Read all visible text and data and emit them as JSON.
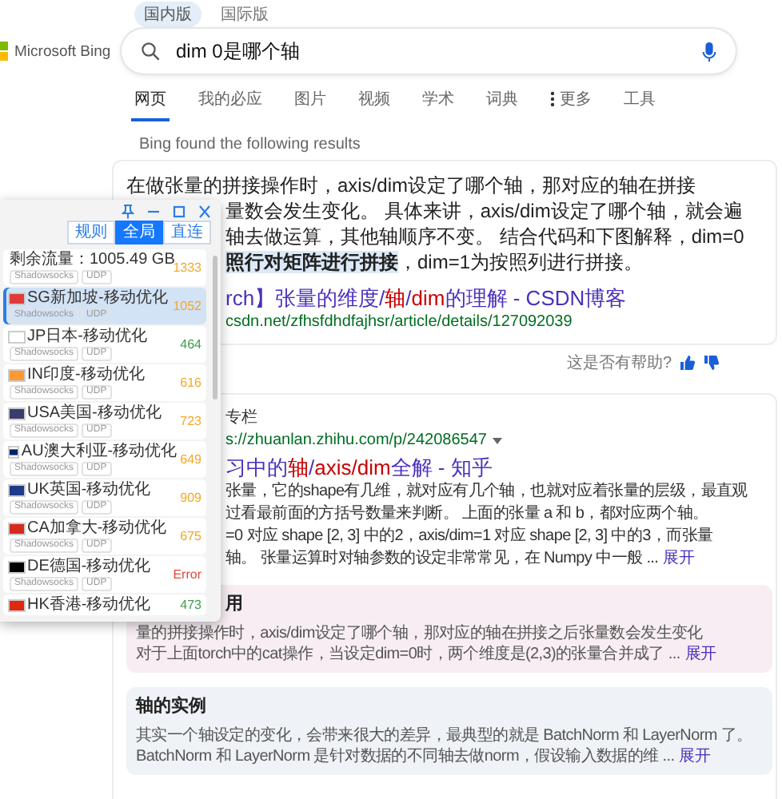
{
  "region_tabs": [
    {
      "label": "国内版",
      "selected": true
    },
    {
      "label": "国际版",
      "selected": false
    }
  ],
  "logo": {
    "text": "Microsoft Bing"
  },
  "search": {
    "value": "dim 0是哪个轴"
  },
  "nav": [
    {
      "label": "网页",
      "kind": "link",
      "selected": true
    },
    {
      "label": "我的必应",
      "kind": "link",
      "selected": false
    },
    {
      "label": "图片",
      "kind": "link",
      "selected": false
    },
    {
      "label": "视频",
      "kind": "link",
      "selected": false
    },
    {
      "label": "学术",
      "kind": "link",
      "selected": false
    },
    {
      "label": "词典",
      "kind": "link",
      "selected": false
    },
    {
      "label": "更多",
      "kind": "menu",
      "selected": false
    },
    {
      "label": "工具",
      "kind": "link",
      "selected": false
    }
  ],
  "results_heading": "Bing found the following results",
  "answer": {
    "lines": [
      "在做张量的拼接操作时，axis/dim设定了哪个轴，那对应的轴在拼接",
      "量数会发生变化。 具体来讲，axis/dim设定了哪个轴，就会遍",
      "轴去做运算，其他轴顺序不变。 结合代码和下图解释，dim=0",
      "**照行对矩阵进行拼接**，dim=1为按照列进行拼接。"
    ],
    "title": "rch】张量的维度/**轴**/**dim**的理解 - CSDN博客",
    "url": "csdn.net/zfhsfdhdfajhsr/article/details/127092039",
    "feedback": "这是否有帮助?"
  },
  "result": {
    "source": "专栏",
    "url": "s://zhuanlan.zhihu.com/p/242086547",
    "title": "习中的**轴**/**axis/dim**全解 - 知乎",
    "lines": [
      "张量，它的shape有几维，就对应有几个轴，也就对应着张量的层级，最直观",
      "过看最前面的方括号数量来判断。 上面的张量 a 和 b，都对应两个轴。",
      "=0 对应 shape [2, 3] 中的2，axis/dim=1 对应 shape [2, 3] 中的3，而张量",
      "轴。 张量运算时对轴参数的设定非常常见，在 Numpy 中一般 ..."
    ],
    "more": "展开",
    "sections": [
      {
        "heading": "用",
        "color": "#f7edf2",
        "lines": [
          "量的拼接操作时，axis/dim设定了哪个轴，那对应的轴在拼接之后张量数会发生变化",
          "对于上面torch中的cat操作，当设定dim=0时，两个维度是(2,3)的张量合并成了 ..."
        ],
        "more": "展开"
      },
      {
        "heading": "轴的实例",
        "color": "#eff2f6",
        "lines": [
          "其实一个轴设定的变化，会带来很大的差异，最典型的就是 BatchNorm 和 LayerNorm 了。",
          "BatchNorm 和 LayerNorm 是针对数据的不同轴去做norm，假设输入数据的维 ..."
        ],
        "more": "展开"
      }
    ]
  },
  "proxy_window": {
    "modes": [
      {
        "label": "规则",
        "selected": false
      },
      {
        "label": "全局",
        "selected": true
      },
      {
        "label": "直连",
        "selected": false
      }
    ],
    "nodes": [
      {
        "name": "剩余流量：1005.49 GB",
        "tags": [
          "Shadowsocks",
          "UDP"
        ],
        "latency": {
          "text": "1333",
          "color": "#f5a623"
        },
        "selected": false
      },
      {
        "name": "SG新加坡-移动优化",
        "flag": {
          "color": "#df3b3b"
        },
        "tags": [
          "Shadowsocks",
          "UDP"
        ],
        "latency": {
          "text": "1052",
          "color": "#f5a623"
        },
        "selected": true
      },
      {
        "name": "JP日本-移动优化",
        "flag": {
          "color": "#ffffff"
        },
        "tags": [
          "Shadowsocks",
          "UDP"
        ],
        "latency": {
          "text": "464",
          "color": "#3b9a4a"
        },
        "selected": false
      },
      {
        "name": "IN印度-移动优化",
        "flag": {
          "color": "#ff9933"
        },
        "tags": [
          "Shadowsocks",
          "UDP"
        ],
        "latency": {
          "text": "616",
          "color": "#f5a623"
        },
        "selected": false
      },
      {
        "name": "USA美国-移动优化",
        "flag": {
          "color": "#3c3b6e"
        },
        "tags": [
          "Shadowsocks",
          "UDP"
        ],
        "latency": {
          "text": "723",
          "color": "#f5a623"
        },
        "selected": false
      },
      {
        "name": "AU澳大利亚-移动优化",
        "flag": {
          "color": "#012169"
        },
        "tags": [
          "Shadowsocks",
          "UDP"
        ],
        "latency": {
          "text": "649",
          "color": "#f5a623"
        },
        "selected": false
      },
      {
        "name": "UK英国-移动优化",
        "flag": {
          "color": "#1f3a8a"
        },
        "tags": [
          "Shadowsocks",
          "UDP"
        ],
        "latency": {
          "text": "909",
          "color": "#f5a623"
        },
        "selected": false
      },
      {
        "name": "CA加拿大-移动优化",
        "flag": {
          "color": "#d52b1e"
        },
        "tags": [
          "Shadowsocks",
          "UDP"
        ],
        "latency": {
          "text": "675",
          "color": "#f5a623"
        },
        "selected": false
      },
      {
        "name": "DE德国-移动优化",
        "flag": {
          "color": "#000000"
        },
        "tags": [
          "Shadowsocks",
          "UDP"
        ],
        "latency": {
          "text": "Error",
          "color": "#e5483a"
        },
        "selected": false
      },
      {
        "name": "HK香港-移动优化",
        "flag": {
          "color": "#de2910"
        },
        "latency": {
          "text": "473",
          "color": "#3b9a4a"
        },
        "selected": false
      }
    ]
  }
}
